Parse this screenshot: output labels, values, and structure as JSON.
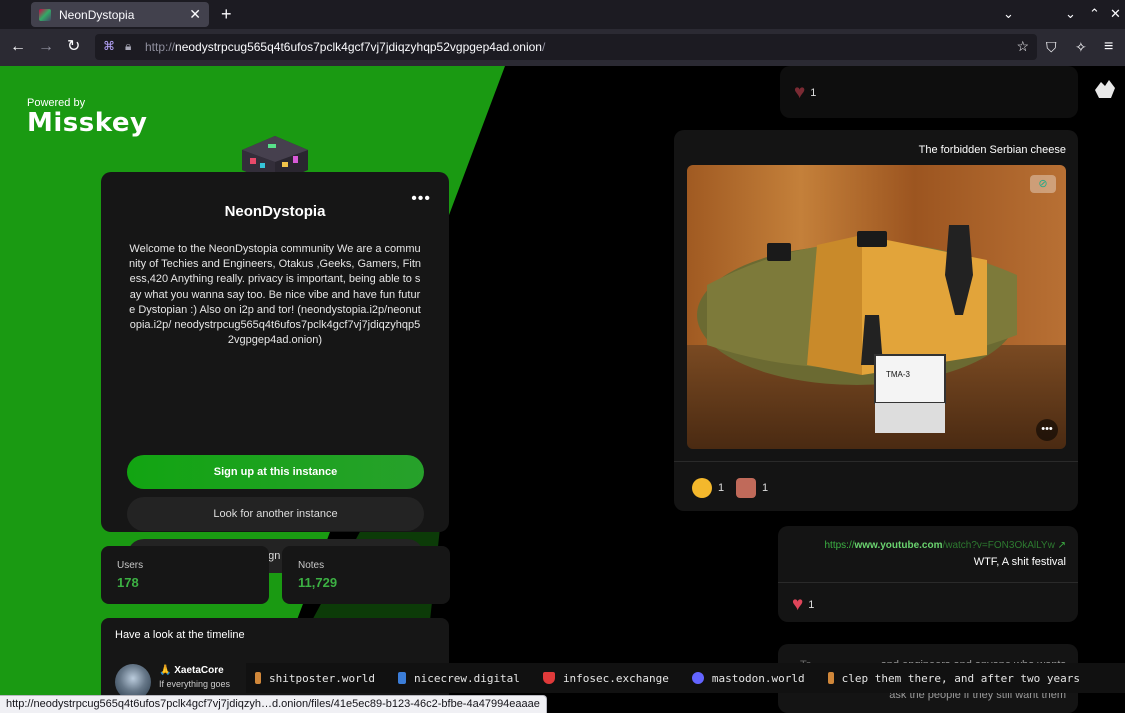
{
  "browser": {
    "tab_title": "NeonDystopia",
    "tab_close": "✕",
    "new_tab": "+",
    "url_prefix": "http://",
    "url_host": "neodystrpcug565q4t6ufos7pclk4gcf7vj7jdiqzyhqp52vgpgep4ad.onion",
    "url_suffix": "/",
    "status_url": "http://neodystrpcug565q4t6ufos7pclk4gcf7vj7jdiqzyh…d.onion/files/41e5ec89-b123-46c2-bfbe-4a47994eaaae"
  },
  "brand": {
    "powered_by": "Powered by",
    "name": "Misskey"
  },
  "instance": {
    "name": "NeonDystopia",
    "more": "•••",
    "description": "Welcome to the NeonDystopia community We are a community of Techies and Engineers, Otakus ,Geeks, Gamers, Fitness,420 Anything really. privacy is important, being able to say what you wanna say too. Be nice vibe and have fun future Dystopian :) Also on i2p and tor! (neondystopia.i2p/neonutopia.i2p/ neodystrpcug565q4t6ufos7pclk4gcf7vj7jdiqzyhqp52vgpgep4ad.onion)",
    "signup_label": "Sign up at this instance",
    "look_label": "Look for another instance",
    "signin_label": "Sign In"
  },
  "stats": {
    "users_label": "Users",
    "users_value": "178",
    "notes_label": "Notes",
    "notes_value": "11,729"
  },
  "timeline": {
    "heading": "Have a look at the timeline",
    "user_name": "🙏 XaetaCore",
    "user_text": "If everything goes"
  },
  "notes": {
    "top_count": "1",
    "cheese_caption": "The forbidden Serbian cheese",
    "image_label": "TMA-3",
    "reaction1_count": "1",
    "reaction2_count": "1",
    "link_prefix": "https://",
    "link_host": "www.youtube.com",
    "link_path": "/watch?v=FON3OkAlLYw",
    "festival_text": "WTF, A shit festival",
    "festival_count": "1",
    "bottom_line1": "and engineers and anyone who wants",
    "bottom_line1_lead": "To",
    "bottom_line2": "ask the people if they still want them",
    "bottom_line_mid": "clep them there, and after two years"
  },
  "ticker": [
    {
      "label": "shitposter.world",
      "color": "#d0873a"
    },
    {
      "label": "nicecrew.digital",
      "color": "#3b7dd8"
    },
    {
      "label": "infosec.exchange",
      "color": "#e03a3a"
    },
    {
      "label": "mastodon.world",
      "color": "#6364ff"
    },
    {
      "label": "clep them there, and after two years",
      "color": "#d0873a"
    }
  ]
}
